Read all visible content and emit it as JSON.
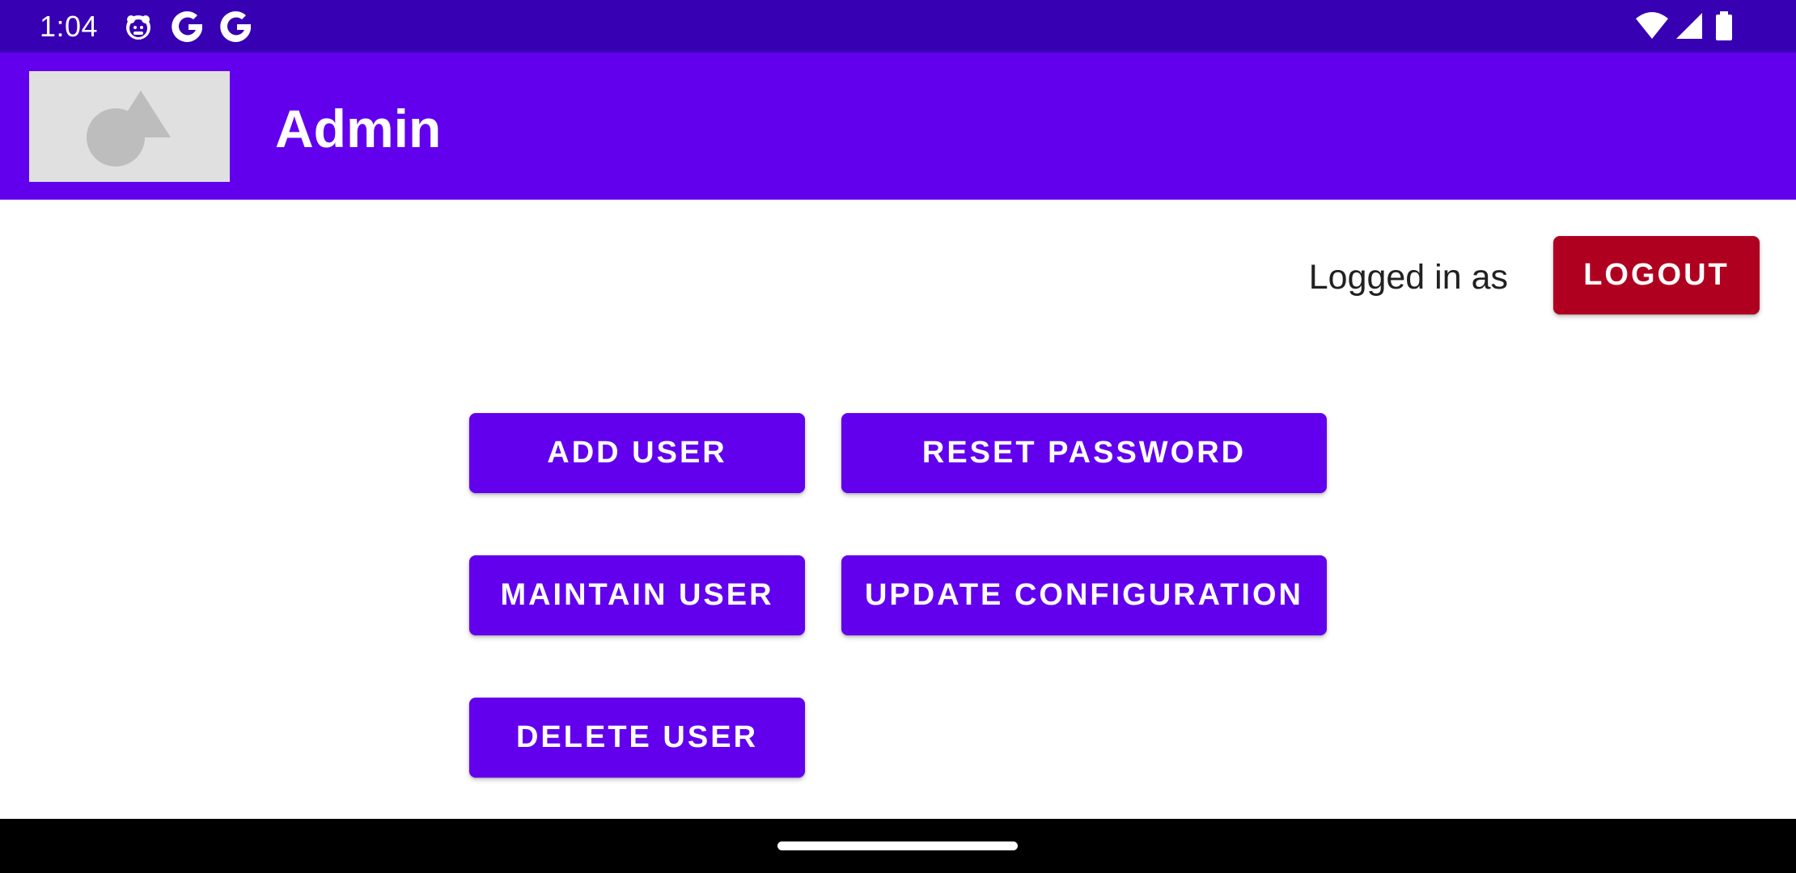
{
  "status_bar": {
    "time": "1:04",
    "left_icons": [
      "notification-app-icon",
      "google-icon",
      "google-icon"
    ],
    "right_icons": [
      "wifi-icon",
      "cell-signal-icon",
      "battery-icon"
    ]
  },
  "app_bar": {
    "title": "Admin",
    "logo_icon": "image-placeholder-icon"
  },
  "session": {
    "logged_in_label": "Logged in as",
    "logout_label": "LOGOUT"
  },
  "actions": {
    "add_user": "ADD USER",
    "reset_password": "RESET PASSWORD",
    "maintain_user": "MAINTAIN USER",
    "update_configuration": "UPDATE CONFIGURATION",
    "delete_user": "DELETE USER"
  },
  "colors": {
    "status_bar": "#3700b3",
    "primary": "#6200ee",
    "danger": "#b00020",
    "nav_bar": "#000000"
  }
}
